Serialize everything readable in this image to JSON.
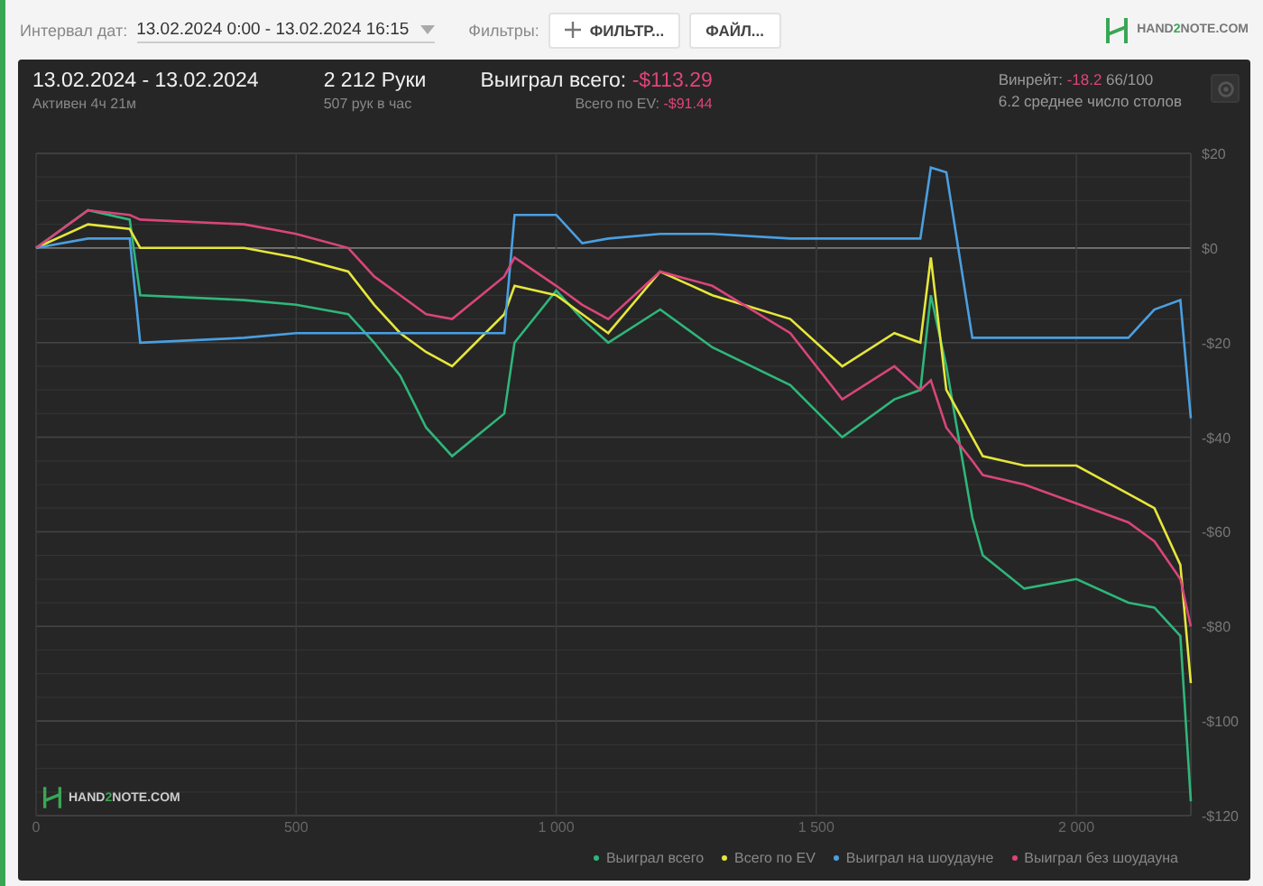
{
  "toolbar": {
    "date_label": "Интервал дат:",
    "date_value": "13.02.2024 0:00 - 13.02.2024 16:15",
    "filters_label": "Фильтры:",
    "buttons": [
      {
        "label": "ФИЛЬТР...",
        "kind": "add"
      },
      {
        "label": "ФАЙЛ...",
        "kind": "plain"
      }
    ],
    "logo": {
      "before": "HAND",
      "accent": "2",
      "after": "NOTE.COM"
    }
  },
  "summary": {
    "period": "13.02.2024 - 13.02.2024",
    "active": "Активен 4ч 21м",
    "hands": "2 212 Руки",
    "hands_rate": "507 рук в час",
    "won_label": "Выиграл всего:",
    "won_value": "-$113.29",
    "ev_label": "Всего по EV:",
    "ev_value": "-$91.44",
    "winrate_label": "Винрейт:",
    "winrate_value": "-18.2",
    "winrate_unit": "66/100",
    "tables": "6.2 среднее число столов"
  },
  "chart": {
    "watermark": {
      "before": "HAND",
      "accent": "2",
      "after": "NOTE.COM"
    },
    "chart_data": {
      "type": "line",
      "grid": true,
      "x": [
        0,
        100,
        180,
        200,
        400,
        500,
        600,
        650,
        700,
        750,
        800,
        900,
        920,
        1000,
        1050,
        1100,
        1200,
        1300,
        1450,
        1550,
        1650,
        1700,
        1720,
        1750,
        1800,
        1820,
        1900,
        2000,
        2100,
        2150,
        2200,
        2220
      ],
      "xlim": [
        0,
        2220
      ],
      "ylim": [
        -120,
        20
      ],
      "xticks": [
        0,
        500,
        {
          "value": 1000,
          "label": "1 000"
        },
        {
          "value": 1500,
          "label": "1 500"
        },
        {
          "value": 2000,
          "label": "2 000"
        }
      ],
      "yticks": [
        {
          "value": 20,
          "label": "$20"
        },
        {
          "value": 0,
          "label": "$0"
        },
        {
          "value": -20,
          "label": "-$20"
        },
        {
          "value": -40,
          "label": "-$40"
        },
        {
          "value": -60,
          "label": "-$60"
        },
        {
          "value": -80,
          "label": "-$80"
        },
        {
          "value": -100,
          "label": "-$100"
        },
        {
          "value": -120,
          "label": "-$120"
        }
      ],
      "series": [
        {
          "name": "Выиграл всего",
          "color": "#2fb67a",
          "values": [
            0,
            8,
            6,
            -10,
            -11,
            -12,
            -14,
            -20,
            -27,
            -38,
            -44,
            -35,
            -20,
            -9,
            -15,
            -20,
            -13,
            -21,
            -29,
            -40,
            -32,
            -30,
            -10,
            -25,
            -57,
            -65,
            -72,
            -70,
            -75,
            -76,
            -82,
            -117
          ]
        },
        {
          "name": "Всего по EV",
          "color": "#e6e63c",
          "values": [
            0,
            5,
            4,
            0,
            0,
            -2,
            -5,
            -12,
            -18,
            -22,
            -25,
            -14,
            -8,
            -10,
            -14,
            -18,
            -5,
            -10,
            -15,
            -25,
            -18,
            -20,
            -2,
            -30,
            -40,
            -44,
            -46,
            -46,
            -52,
            -55,
            -67,
            -92
          ]
        },
        {
          "name": "Выиграл на шоудауне",
          "color": "#4a9fe0",
          "values": [
            0,
            2,
            2,
            -20,
            -19,
            -18,
            -18,
            -18,
            -18,
            -18,
            -18,
            -18,
            7,
            7,
            1,
            2,
            3,
            3,
            2,
            2,
            2,
            2,
            17,
            16,
            -19,
            -19,
            -19,
            -19,
            -19,
            -13,
            -11,
            -36
          ]
        },
        {
          "name": "Выиграл без шоудауна",
          "color": "#d9457a",
          "values": [
            0,
            8,
            7,
            6,
            5,
            3,
            0,
            -6,
            -10,
            -14,
            -15,
            -6,
            -2,
            -8,
            -12,
            -15,
            -5,
            -8,
            -18,
            -32,
            -25,
            -30,
            -28,
            -38,
            -45,
            -48,
            -50,
            -54,
            -58,
            -62,
            -70,
            -80
          ]
        }
      ]
    }
  }
}
